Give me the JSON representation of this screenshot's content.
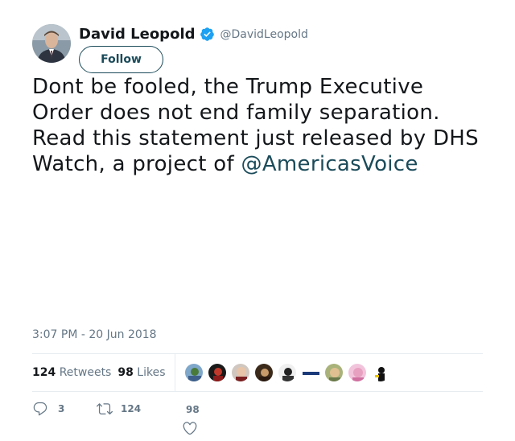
{
  "user": {
    "name": "David Leopold",
    "handle": "@DavidLeopold",
    "verified": true
  },
  "follow_button": {
    "label": "Follow"
  },
  "tweet": {
    "text": "Dont be fooled, the Trump Executive Order does not end family separation. Read this statement just released by DHS Watch, a project of",
    "mention": "@AmericasVoice",
    "timestamp": "3:07 PM - 20 Jun 2018"
  },
  "stats": {
    "retweets_count": "124",
    "retweets_label": "Retweets",
    "likes_count": "98",
    "likes_label": "Likes"
  },
  "actions": {
    "reply_count": "3",
    "retweet_count": "124",
    "like_count": "98"
  },
  "colors": {
    "accent": "#1b4b5a",
    "secondary_text": "#657786",
    "verified": "#1da1f2",
    "divider": "#e6ecf0"
  }
}
